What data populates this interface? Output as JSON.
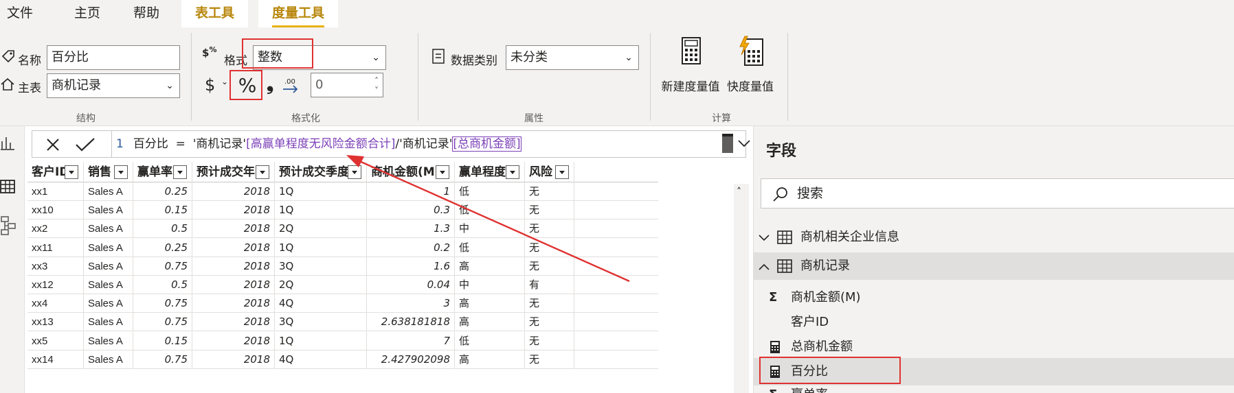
{
  "menu": {
    "file": "文件",
    "home": "主页",
    "help": "帮助",
    "table_tools": "表工具",
    "measure_tools": "度量工具"
  },
  "ribbon": {
    "structure": {
      "name_label": "名称",
      "name_value": "百分比",
      "home_table_label": "主表",
      "home_table_value": "商机记录",
      "group_label": "结构"
    },
    "format": {
      "format_label": "格式",
      "format_value": "整数",
      "currency_symbol": "$",
      "percent_symbol": "%",
      "comma_symbol": "❟",
      "decimals_value": "0",
      "group_label": "格式化"
    },
    "properties": {
      "data_category_label": "数据类别",
      "data_category_value": "未分类",
      "group_label": "属性"
    },
    "calculations": {
      "new_measure": "新建度量值",
      "quick_measure": "快度量值",
      "group_label": "计算"
    }
  },
  "formula": {
    "line_number": "1",
    "measure_name": "百分比",
    "equals": "=",
    "table_ref_1": "'商机记录'",
    "column_ref_1": "[高赢单程度无风险金额合计]",
    "divide": "/",
    "table_ref_2": "'商机记录'",
    "column_ref_2": "[总商机金额]"
  },
  "table": {
    "columns": [
      "客户ID",
      "销售",
      "赢单率",
      "预计成交年",
      "预计成交季度",
      "商机金额(M)",
      "赢单程度",
      "风险"
    ],
    "rows": [
      [
        "xx1",
        "Sales A",
        "0.25",
        "2018",
        "1Q",
        "1",
        "低",
        "无"
      ],
      [
        "xx10",
        "Sales A",
        "0.15",
        "2018",
        "1Q",
        "0.3",
        "低",
        "无"
      ],
      [
        "xx2",
        "Sales A",
        "0.5",
        "2018",
        "2Q",
        "1.3",
        "中",
        "无"
      ],
      [
        "xx11",
        "Sales A",
        "0.25",
        "2018",
        "1Q",
        "0.2",
        "低",
        "无"
      ],
      [
        "xx3",
        "Sales A",
        "0.75",
        "2018",
        "3Q",
        "1.6",
        "高",
        "无"
      ],
      [
        "xx12",
        "Sales A",
        "0.5",
        "2018",
        "2Q",
        "0.04",
        "中",
        "有"
      ],
      [
        "xx4",
        "Sales A",
        "0.75",
        "2018",
        "4Q",
        "3",
        "高",
        "无"
      ],
      [
        "xx13",
        "Sales A",
        "0.75",
        "2018",
        "3Q",
        "2.638181818",
        "高",
        "无"
      ],
      [
        "xx5",
        "Sales A",
        "0.15",
        "2018",
        "1Q",
        "7",
        "低",
        "无"
      ],
      [
        "xx14",
        "Sales A",
        "0.75",
        "2018",
        "4Q",
        "2.427902098",
        "高",
        "无"
      ]
    ]
  },
  "fields_pane": {
    "title": "字段",
    "search_placeholder": "搜索",
    "tables": [
      {
        "name": "商机相关企业信息",
        "expanded": false
      },
      {
        "name": "商机记录",
        "expanded": true
      }
    ],
    "items": [
      {
        "name": "商机金额(M)",
        "icon": "sigma-icon"
      },
      {
        "name": "客户ID",
        "icon": ""
      },
      {
        "name": "总商机金额",
        "icon": "calculator-icon"
      },
      {
        "name": "百分比",
        "icon": "calculator-icon"
      },
      {
        "name": "赢单率",
        "icon": "sigma-icon"
      }
    ]
  },
  "colors": {
    "accent": "#e8b20c",
    "highlight": "#e03131",
    "formula_column": "#7b3fb7"
  }
}
